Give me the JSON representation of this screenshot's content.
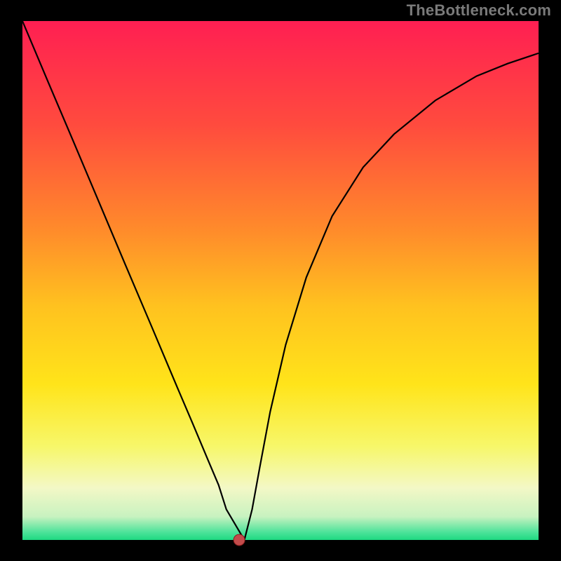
{
  "watermark": "TheBottleneck.com",
  "colors": {
    "frame": "#000000",
    "curve": "#000000",
    "dot": "#c24b4b",
    "dot_stroke": "#8a1d1d"
  },
  "chart_data": {
    "type": "line",
    "title": "",
    "xlabel": "",
    "ylabel": "",
    "xlim": [
      0,
      1
    ],
    "ylim": [
      0,
      1
    ],
    "gradient_stops": [
      {
        "offset": 0.0,
        "color": "#ff1f52"
      },
      {
        "offset": 0.2,
        "color": "#ff4b3e"
      },
      {
        "offset": 0.4,
        "color": "#ff8a2b"
      },
      {
        "offset": 0.55,
        "color": "#ffc21f"
      },
      {
        "offset": 0.7,
        "color": "#ffe41a"
      },
      {
        "offset": 0.82,
        "color": "#f7f76a"
      },
      {
        "offset": 0.9,
        "color": "#f3f8c6"
      },
      {
        "offset": 0.955,
        "color": "#c8f2c0"
      },
      {
        "offset": 0.985,
        "color": "#4de39a"
      },
      {
        "offset": 1.0,
        "color": "#1ed981"
      }
    ],
    "series": [
      {
        "name": "bottleneck-curve",
        "x": [
          0.0,
          0.05,
          0.1,
          0.15,
          0.2,
          0.25,
          0.3,
          0.33,
          0.36,
          0.38,
          0.395,
          0.405,
          0.415,
          0.43,
          0.445,
          0.46,
          0.48,
          0.51,
          0.55,
          0.6,
          0.66,
          0.72,
          0.8,
          0.88,
          0.94,
          1.0
        ],
        "y": [
          1.0,
          0.882,
          0.765,
          0.647,
          0.529,
          0.412,
          0.294,
          0.224,
          0.153,
          0.106,
          0.059,
          0.018,
          0.0,
          0.0,
          0.059,
          0.141,
          0.247,
          0.376,
          0.506,
          0.624,
          0.718,
          0.782,
          0.847,
          0.894,
          0.918,
          0.938
        ]
      }
    ],
    "marker": {
      "x": 0.42,
      "y": 0.0
    },
    "plateau": {
      "x0": 0.395,
      "x1": 0.43,
      "y": 0.0
    }
  }
}
